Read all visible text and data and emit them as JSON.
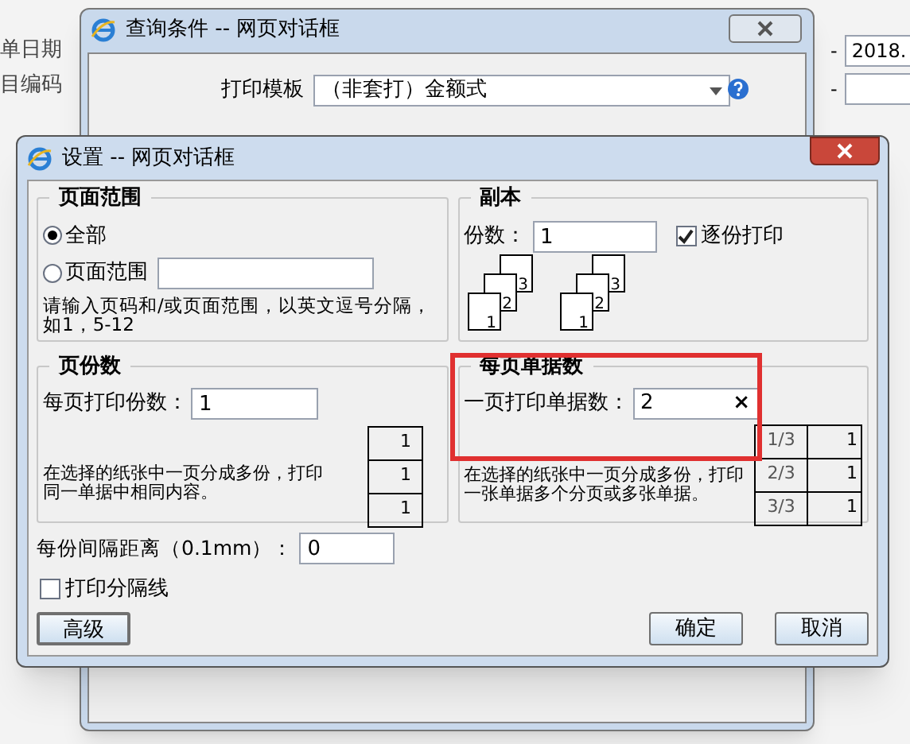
{
  "background": {
    "fields": [
      {
        "label": "单日期",
        "dash": "-"
      },
      {
        "label": "目编码",
        "dash": "-"
      }
    ],
    "date_value": "2018."
  },
  "query_dialog": {
    "title": "查询条件 -- 网页对话框",
    "template_label": "打印模板",
    "template_value": "（非套打）金额式"
  },
  "settings_dialog": {
    "title": "设置 -- 网页对话框",
    "page_range": {
      "legend": "页面范围",
      "options": [
        {
          "label": "全部",
          "selected": true
        },
        {
          "label": "页面范围",
          "selected": false
        }
      ],
      "hint": "请输入页码和/或页面范围，以英文逗号分隔，如1，5-12"
    },
    "copies": {
      "legend": "副本",
      "count_label": "份数：",
      "count_value": "1",
      "collate": {
        "label": "逐份打印",
        "checked": true
      },
      "stacks": [
        {
          "pages": [
            "3",
            "2",
            "1"
          ]
        },
        {
          "pages": [
            "3",
            "2",
            "1"
          ]
        }
      ]
    },
    "per_page_copies": {
      "legend": "页份数",
      "label": "每页打印份数：",
      "value": "1",
      "description": "在选择的纸张中一页分成多份，打印同一单据中相同内容。",
      "table": [
        "1",
        "1",
        "1"
      ]
    },
    "per_page_bills": {
      "legend": "每页单据数",
      "label": "一页打印单据数：",
      "value": "2",
      "clear": "×",
      "description": "在选择的纸张中一页分成多份，打印一张单据多个分页或多张单据。",
      "table": [
        [
          "1/3",
          "1"
        ],
        [
          "2/3",
          "1"
        ],
        [
          "3/3",
          "1"
        ]
      ]
    },
    "spacing": {
      "label": "每份间隔距离（0.1mm）：",
      "value": "0"
    },
    "divider": {
      "label": "打印分隔线",
      "checked": false
    },
    "buttons": {
      "advanced": "高级",
      "ok": "确定",
      "cancel": "取消"
    }
  }
}
